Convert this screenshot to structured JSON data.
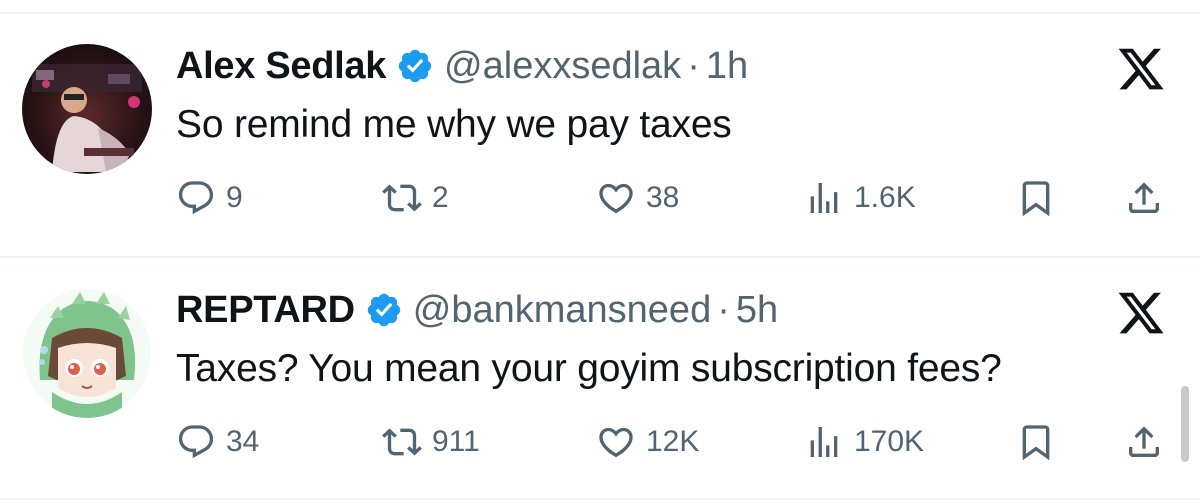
{
  "tweets": [
    {
      "name": "Alex Sedlak",
      "handle": "@alexxsedlak",
      "separator": "·",
      "time": "1h",
      "text": "So remind me why we pay taxes",
      "replies": "9",
      "reposts": "2",
      "likes": "38",
      "views": "1.6K"
    },
    {
      "name": "REPTARD",
      "handle": "@bankmansneed",
      "separator": "·",
      "time": "5h",
      "text": "Taxes? You mean your goyim subscription fees?",
      "replies": "34",
      "reposts": "911",
      "likes": "12K",
      "views": "170K"
    }
  ],
  "colors": {
    "text_primary": "#0f1419",
    "text_secondary": "#536471",
    "verified_blue": "#1d9bf0",
    "divider": "#eff3f4"
  },
  "icons": [
    "verified-badge-icon",
    "x-logo-icon",
    "reply-icon",
    "repost-icon",
    "like-icon",
    "views-icon",
    "bookmark-icon",
    "share-icon"
  ]
}
